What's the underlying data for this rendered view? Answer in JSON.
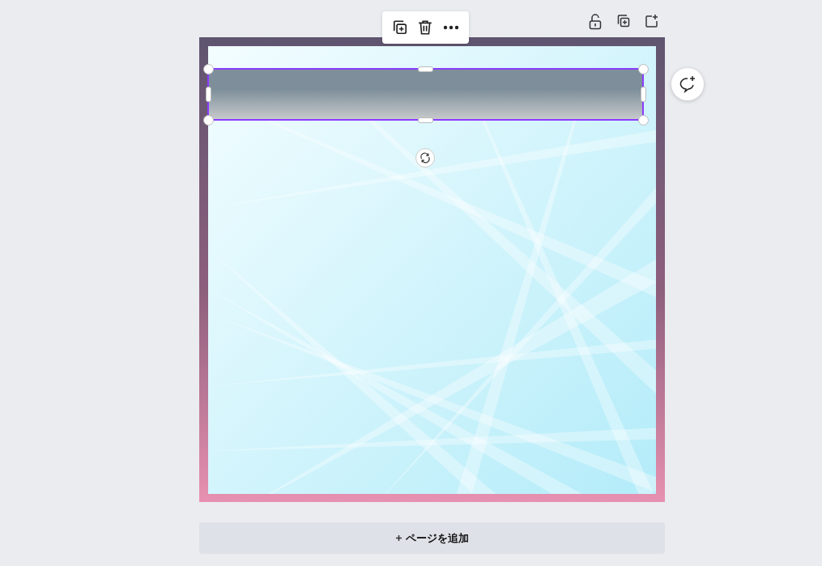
{
  "shape": {
    "selected": true
  },
  "add_page_button": {
    "label": "ページを追加"
  }
}
